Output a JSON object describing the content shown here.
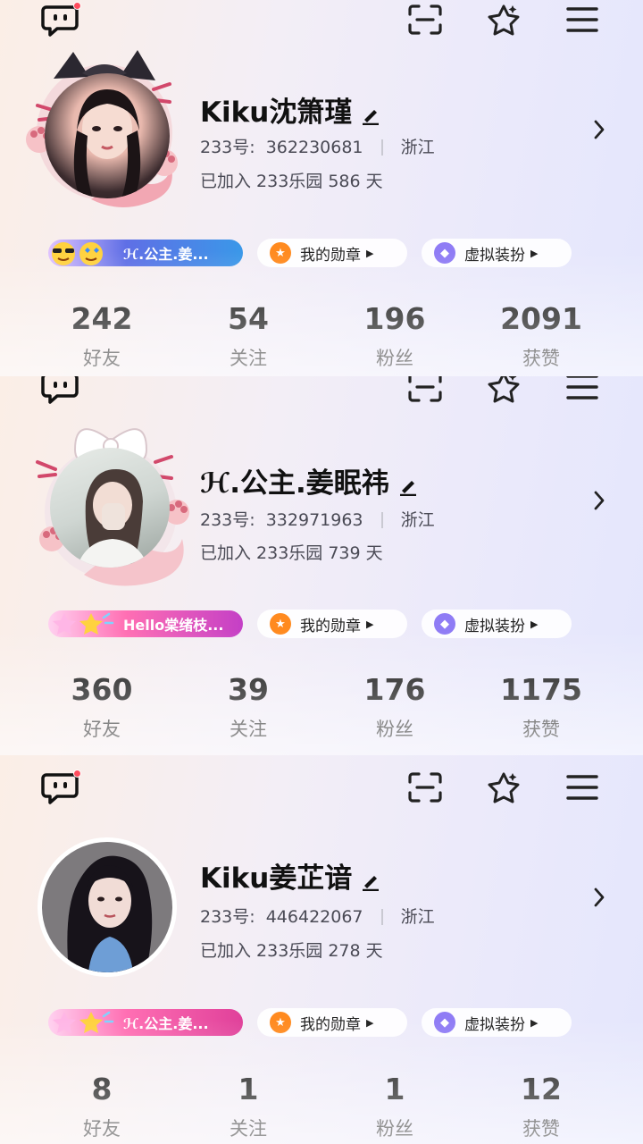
{
  "profiles": [
    {
      "name": "Kiku沈箫瑾",
      "id_label": "233号:",
      "id": "362230681",
      "region": "浙江",
      "joined": "已加入 233乐园 586 天",
      "badge_text": "ℋ.公主.姜...",
      "medal_label": "我的勋章",
      "dressup_label": "虚拟装扮",
      "stats": [
        {
          "value": "242",
          "label": "好友"
        },
        {
          "value": "54",
          "label": "关注"
        },
        {
          "value": "196",
          "label": "粉丝"
        },
        {
          "value": "2091",
          "label": "获赞"
        }
      ]
    },
    {
      "name": "ℋ.公主.姜眠祎",
      "id_label": "233号:",
      "id": "332971963",
      "region": "浙江",
      "joined": "已加入 233乐园 739 天",
      "badge_text": "Hello棠绪枝...",
      "medal_label": "我的勋章",
      "dressup_label": "虚拟装扮",
      "stats": [
        {
          "value": "360",
          "label": "好友"
        },
        {
          "value": "39",
          "label": "关注"
        },
        {
          "value": "176",
          "label": "粉丝"
        },
        {
          "value": "1175",
          "label": "获赞"
        }
      ]
    },
    {
      "name": "Kiku姜芷谙",
      "id_label": "233号:",
      "id": "446422067",
      "region": "浙江",
      "joined": "已加入 233乐园 278 天",
      "badge_text": "ℋ.公主.姜...",
      "medal_label": "我的勋章",
      "dressup_label": "虚拟装扮",
      "stats": [
        {
          "value": "8",
          "label": "好友"
        },
        {
          "value": "1",
          "label": "关注"
        },
        {
          "value": "1",
          "label": "粉丝"
        },
        {
          "value": "12",
          "label": "获赞"
        }
      ]
    }
  ],
  "icons": {
    "chat": "chat-bubble-icon",
    "scan": "scan-icon",
    "collect": "sparkle-star-icon",
    "menu": "hamburger-menu-icon",
    "medal": "medal-icon",
    "dressup": "cat-mask-icon"
  },
  "colors": {
    "badge_gradient_1": [
      "#6b8cf0",
      "#b35fd8"
    ],
    "badge_gradient_2": [
      "#ff6fb3",
      "#c43fc6"
    ],
    "medal_orange": "#ff8a1f",
    "dressup_purple": "#8f7cf5",
    "notify_dot": "#ff4d5e"
  }
}
